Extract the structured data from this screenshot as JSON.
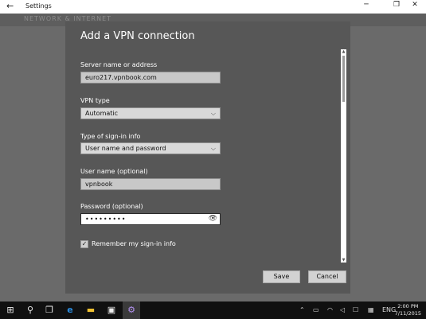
{
  "window": {
    "title": "Settings"
  },
  "background_header": "NETWORK & INTERNET",
  "dialog": {
    "title": "Add a VPN connection",
    "server": {
      "label": "Server name or address",
      "value": "euro217.vpnbook.com"
    },
    "vpn_type": {
      "label": "VPN type",
      "value": "Automatic"
    },
    "signin_type": {
      "label": "Type of sign-in info",
      "value": "User name and password"
    },
    "username": {
      "label": "User name (optional)",
      "value": "vpnbook"
    },
    "password": {
      "label": "Password (optional)",
      "value": "•••••••••"
    },
    "remember": {
      "label": "Remember my sign-in info",
      "checked": true
    },
    "save_label": "Save",
    "cancel_label": "Cancel"
  },
  "taskbar": {
    "language": "ENG",
    "time": "2:00 PM",
    "date": "7/11/2015"
  }
}
